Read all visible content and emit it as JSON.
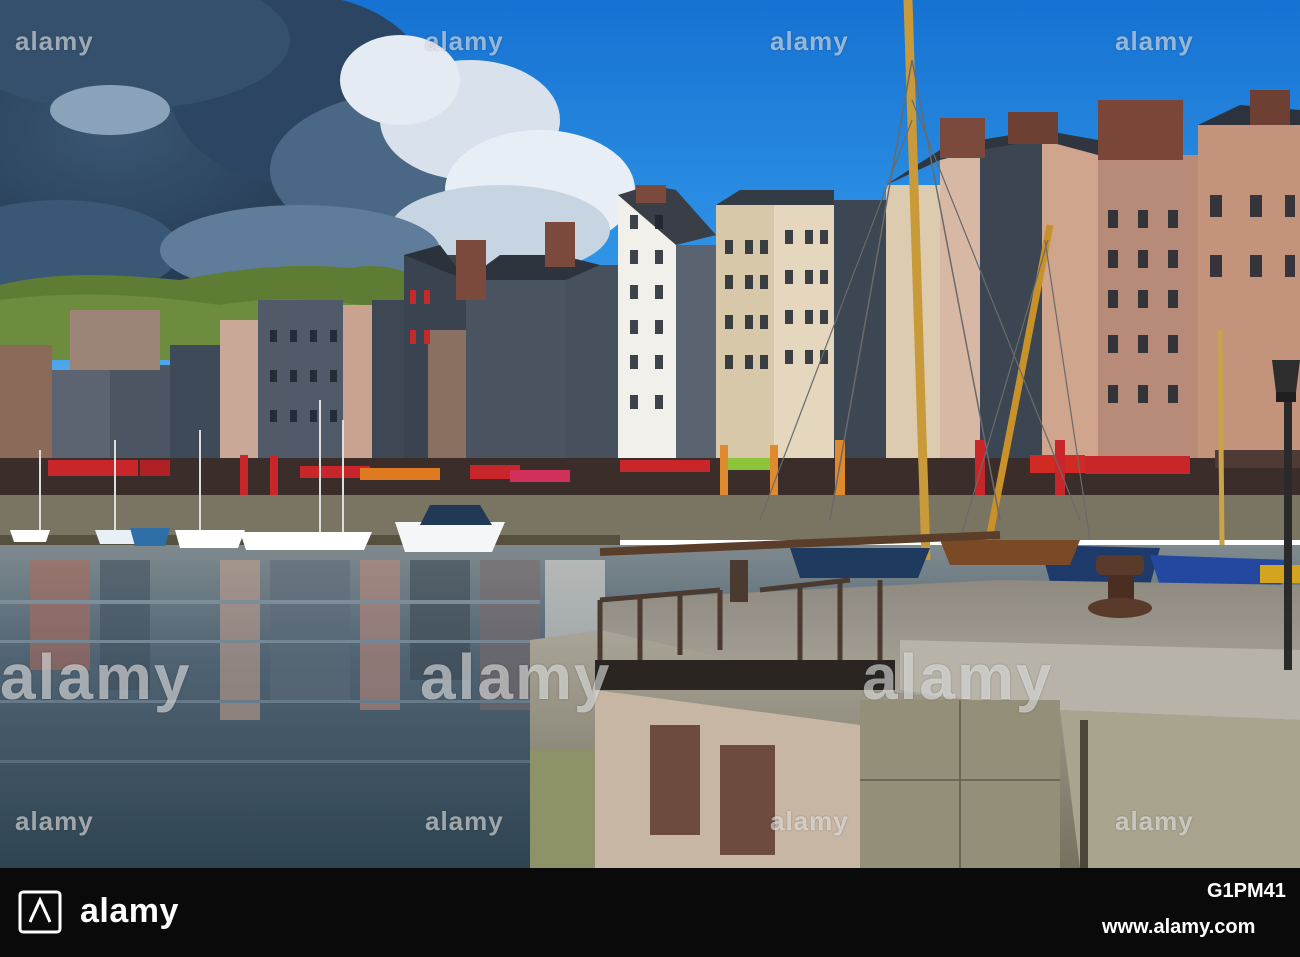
{
  "photo": {
    "subject": "harbour",
    "colors": {
      "sky_top": "#1a7ad8",
      "sky_low": "#5ab0f0",
      "cloud_dark": "#27405c",
      "cloud_light": "#e8eef5",
      "water": "#3e5565",
      "hill": "#5f7c35",
      "quay": "#9a9488",
      "awning_red": "#c8262a"
    }
  },
  "watermark": {
    "brand": "alamy",
    "image_id": "G1PM41",
    "site": "www.alamy.com"
  }
}
